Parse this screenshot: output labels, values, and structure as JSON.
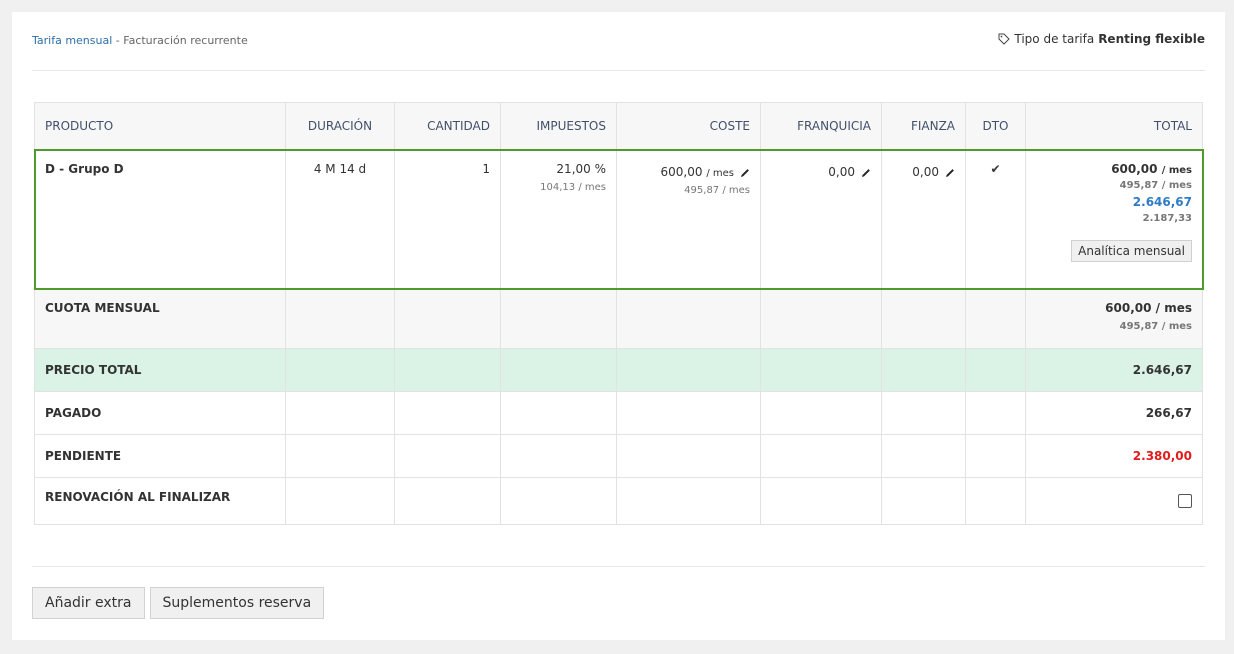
{
  "breadcrumb": {
    "link": "Tarifa mensual",
    "separator": " - ",
    "current": "Facturación recurrente"
  },
  "tarifa": {
    "label": "Tipo de tarifa",
    "value": "Renting flexible"
  },
  "columns": [
    "PRODUCTO",
    "DURACIÓN",
    "CANTIDAD",
    "IMPUESTOS",
    "COSTE",
    "FRANQUICIA",
    "FIANZA",
    "DTO",
    "TOTAL"
  ],
  "product": {
    "name": "D - Grupo D",
    "duration": "4 M 14 d",
    "quantity": "1",
    "tax_pct": "21,00 %",
    "tax_amount": "104,13",
    "tax_unit": "/ mes",
    "cost": "600,00",
    "cost_unit": "/ mes",
    "cost_net": "495,87 / mes",
    "franquicia": "0,00",
    "fianza": "0,00",
    "dto_check": "✔",
    "total_month": "600,00",
    "total_month_unit": "/ mes",
    "total_month_net": "495,87 / mes",
    "total": "2.646,67",
    "total_net": "2.187,33",
    "analytics_button": "Analítica mensual"
  },
  "cuota": {
    "label": "CUOTA MENSUAL",
    "value": "600,00 / mes",
    "net": "495,87 / mes"
  },
  "precio": {
    "label": "PRECIO TOTAL",
    "value": "2.646,67"
  },
  "pagado": {
    "label": "PAGADO",
    "value": "266,67"
  },
  "pendiente": {
    "label": "PENDIENTE",
    "value": "2.380,00"
  },
  "renovacion": {
    "label": "RENOVACIÓN AL FINALIZAR"
  },
  "buttons": {
    "add_extra": "Añadir extra",
    "supplements": "Suplementos reserva"
  },
  "colors": {
    "highlight_border": "#4e9a2b",
    "total_row_bg": "#dbf2e6",
    "pending_red": "#e21b1b",
    "link_blue": "#2f7bc6"
  }
}
